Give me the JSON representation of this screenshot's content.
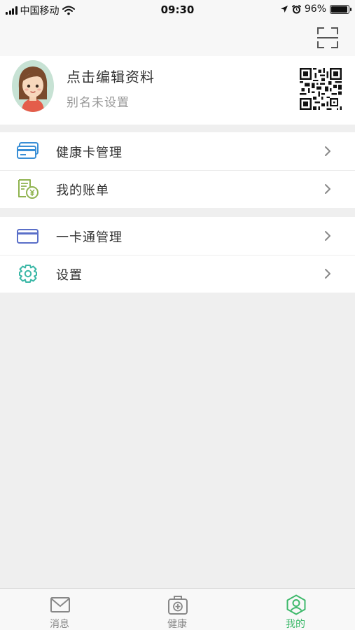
{
  "status_bar": {
    "carrier": "中国移动",
    "time": "09:30",
    "battery_percent": "96%",
    "battery_level": 0.96
  },
  "profile": {
    "name": "点击编辑资料",
    "alias": "别名未设置"
  },
  "menu_group_1": [
    {
      "label": "健康卡管理",
      "icon": "health-card-icon"
    },
    {
      "label": "我的账单",
      "icon": "bill-icon"
    }
  ],
  "menu_group_2": [
    {
      "label": "一卡通管理",
      "icon": "card-icon"
    },
    {
      "label": "设置",
      "icon": "gear-icon"
    }
  ],
  "tabbar": {
    "tabs": [
      {
        "label": "消息",
        "icon": "message-icon",
        "active": false
      },
      {
        "label": "健康",
        "icon": "medical-kit-icon",
        "active": false
      },
      {
        "label": "我的",
        "icon": "profile-icon",
        "active": true
      }
    ]
  },
  "colors": {
    "accent": "#3eb96b",
    "background": "#efefef",
    "card_blue": "#3a8fd6",
    "settings_teal": "#3ab7a6",
    "bill_green": "#8fb34f"
  }
}
